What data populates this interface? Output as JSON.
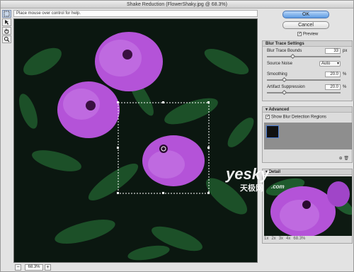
{
  "window": {
    "title": "Shake Reduction (FlowerShaky.jpg @ 68.3%)"
  },
  "hint_text": "Place mouse over control for help.",
  "tools": [
    "move-tool-icon",
    "blur-estimation-tool-icon",
    "hand-tool-icon",
    "zoom-tool-icon"
  ],
  "footer": {
    "zoom_value": "68.3%",
    "minus": "−",
    "plus": "+"
  },
  "buttons": {
    "ok": "OK",
    "cancel": "Cancel"
  },
  "preview": {
    "label": "Preview",
    "checked": true
  },
  "blur_trace": {
    "title": "Blur Trace Settings",
    "bounds_label": "Blur Trace Bounds",
    "bounds_value": "33",
    "bounds_unit": "px",
    "noise_label": "Source Noise",
    "noise_value": "Auto",
    "smoothing_label": "Smoothing",
    "smoothing_value": "20.0",
    "smoothing_unit": "%",
    "artifact_label": "Artifact Suppression",
    "artifact_value": "20.0",
    "artifact_unit": "%"
  },
  "advanced": {
    "title": "Advanced",
    "show_regions_label": "Show Blur Detection Regions",
    "show_regions_checked": true
  },
  "detail": {
    "title": "Detail",
    "zoom_levels": [
      "1x",
      "2x",
      "3x",
      "4x",
      "68.3%"
    ]
  },
  "watermark": {
    "main": "yesky",
    "sub": "天极网",
    "com": ".com"
  },
  "colors": {
    "accent": "#5d9be3",
    "flower": "#b453d8",
    "foliage": "#1f5a2d"
  }
}
